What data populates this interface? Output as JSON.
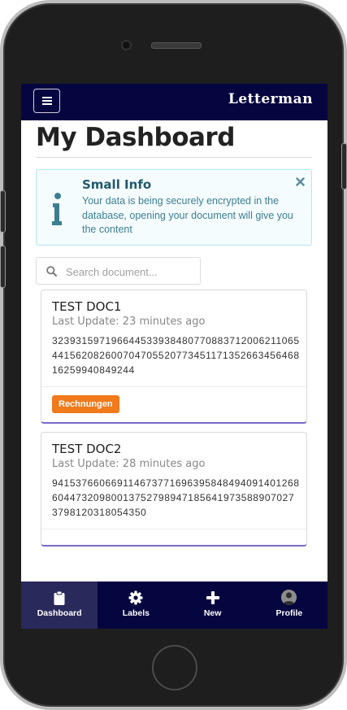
{
  "header": {
    "brand": "Letterman"
  },
  "page": {
    "title": "My Dashboard"
  },
  "info": {
    "title": "Small Info",
    "text": "Your data is being securely encrypted in the database, opening your document will give you the content"
  },
  "search": {
    "placeholder": "Search document...",
    "value": ""
  },
  "documents": [
    {
      "title": "TEST DOC1",
      "updated": "Last Update: 23 minutes ago",
      "id": "32393159719664453393848077088371200621106544156208260070470552077345117135266345646816259940849244",
      "tag": "Rechnungen"
    },
    {
      "title": "TEST DOC2",
      "updated": "Last Update: 28 minutes ago",
      "id": "941537660669114673771696395848494091401268604473209800137527989471856419735889070273798120318054350"
    }
  ],
  "nav": {
    "items": [
      {
        "label": "Dashboard",
        "icon": "clipboard-icon",
        "active": true
      },
      {
        "label": "Labels",
        "icon": "gear-icon"
      },
      {
        "label": "New",
        "icon": "plus-icon"
      },
      {
        "label": "Profile",
        "icon": "avatar"
      }
    ]
  },
  "colors": {
    "navbar": "#050540",
    "nav_active": "#29295c",
    "info_bg": "#f4fcfe",
    "info_text": "#3d7e93",
    "tag": "#f07a1c",
    "card_accent": "#7b68c9"
  }
}
